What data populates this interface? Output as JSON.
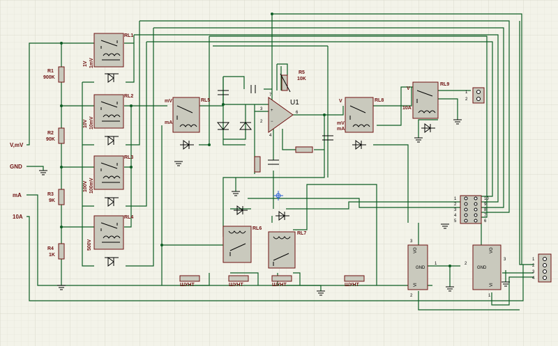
{
  "inputs": [
    {
      "label": "V,mV"
    },
    {
      "label": "GND"
    },
    {
      "label": "mA"
    },
    {
      "label": "10A"
    }
  ],
  "resistors": [
    {
      "ref": "R1",
      "value": "900K"
    },
    {
      "ref": "R2",
      "value": "90K"
    },
    {
      "ref": "R3",
      "value": "9K"
    },
    {
      "ref": "R4",
      "value": "1K"
    },
    {
      "ref": "R5",
      "value": "10K"
    }
  ],
  "relays": [
    {
      "ref": "RL1",
      "labels": [
        "1V",
        "1mV"
      ]
    },
    {
      "ref": "RL2",
      "labels": [
        "10V",
        "10mV"
      ]
    },
    {
      "ref": "RL3",
      "labels": [
        "100V",
        "100mV"
      ]
    },
    {
      "ref": "RL4",
      "labels": [
        "500V"
      ]
    },
    {
      "ref": "RL5",
      "labels": [
        "mV",
        "mA"
      ]
    },
    {
      "ref": "RL6",
      "labels": []
    },
    {
      "ref": "RL7",
      "labels": []
    },
    {
      "ref": "RL8",
      "labels": [
        "V",
        "mV",
        "mA"
      ]
    },
    {
      "ref": "RL9",
      "labels": [
        "V",
        "10A"
      ]
    }
  ],
  "opamp": {
    "ref": "U1",
    "pins": [
      "2",
      "3",
      "4",
      "6",
      "7"
    ]
  },
  "shunts": [
    "ШУНТ",
    "ШУНТ",
    "ШУНТ",
    "ШУНТ"
  ],
  "regulators": [
    {
      "pin_top": "VO",
      "gnd": "GND",
      "pin_bottom": "VI",
      "pin_left": "3",
      "pin_right": "1",
      "pin_vi": "2"
    },
    {
      "pin_top": "VO",
      "gnd": "GND",
      "pin_bottom": "VI",
      "pin_left": "2",
      "pin_right": "3",
      "pin_vi": "1"
    }
  ],
  "connectors": {
    "two_pin": [
      "1",
      "2"
    ],
    "ten_pin_left": [
      "1",
      "2",
      "3",
      "4",
      "5"
    ],
    "ten_pin_right": [
      "10",
      "9",
      "8",
      "7",
      "6"
    ],
    "four_pin": [
      "1",
      "2",
      "3",
      "4"
    ]
  }
}
